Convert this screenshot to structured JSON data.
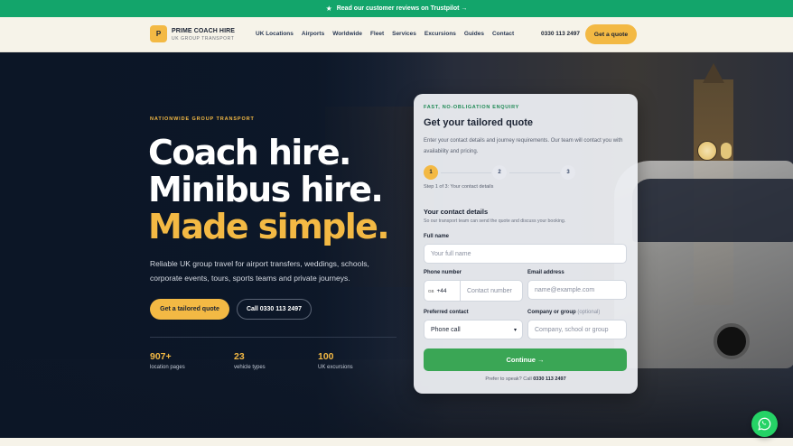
{
  "banner": {
    "icon": "star-icon",
    "text": "Read our customer reviews on Trustpilot →"
  },
  "brand": {
    "logo_letter": "P",
    "name": "PRIME COACH HIRE",
    "tagline": "UK GROUP TRANSPORT",
    "accent": "#f3b944"
  },
  "nav": {
    "items": [
      "UK Locations",
      "Airports",
      "Worldwide",
      "Fleet",
      "Services",
      "Excursions",
      "Guides",
      "Contact"
    ],
    "phone": "0330 113 2497",
    "cta": "Get a quote"
  },
  "hero": {
    "eyebrow": "NATIONWIDE GROUP TRANSPORT",
    "line1": "Coach hire.",
    "line2": "Minibus hire.",
    "line3": "Made simple.",
    "description": "Reliable UK group travel for airport transfers, weddings, schools, corporate events, tours, sports teams and private journeys.",
    "primary_cta": "Get a tailored quote",
    "secondary_cta": "Call 0330 113 2497",
    "stats": [
      {
        "value": "907+",
        "label": "location pages"
      },
      {
        "value": "23",
        "label": "vehicle types"
      },
      {
        "value": "100",
        "label": "UK excursions"
      }
    ]
  },
  "form": {
    "eyebrow": "FAST, NO-OBLIGATION ENQUIRY",
    "title": "Get your tailored quote",
    "description": "Enter your contact details and journey requirements. Our team will contact you with availability and pricing.",
    "steps": [
      "1",
      "2",
      "3"
    ],
    "step_caption": "Step 1 of 3: Your contact details",
    "section_title": "Your contact details",
    "section_sub": "So our transport team can send the quote and discuss your booking.",
    "full_name_label": "Full name",
    "full_name_placeholder": "Your full name",
    "phone_label": "Phone number",
    "country_flag": "GB",
    "country_code": "+44",
    "phone_placeholder": "Contact number",
    "email_label": "Email address",
    "email_placeholder": "name@example.com",
    "preferred_label": "Preferred contact",
    "preferred_value": "Phone call",
    "company_label": "Company or group",
    "company_optional": "(optional)",
    "company_placeholder": "Company, school or group",
    "continue_label": "Continue →",
    "foot_text": "Prefer to speak? Call",
    "foot_phone": "0330 113 2497",
    "success_color": "#3aa655"
  },
  "whatsapp": {
    "icon": "whatsapp-icon",
    "color": "#25d366"
  }
}
